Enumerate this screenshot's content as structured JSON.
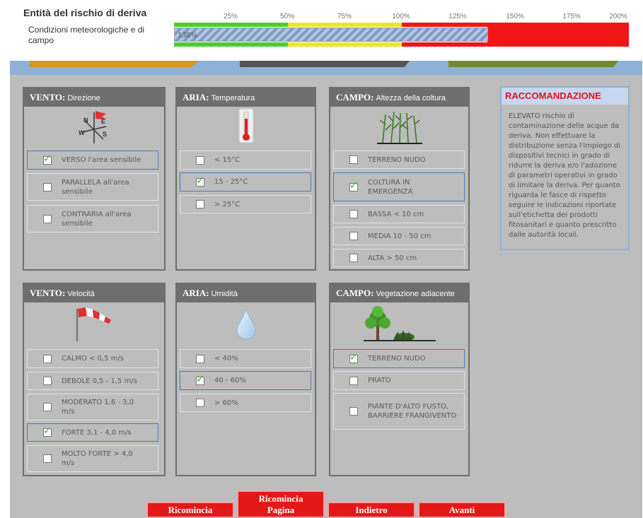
{
  "header": {
    "title": "Entità del rischio di deriva",
    "subtitle": "Condizioni meteorologiche e di campo",
    "scale_labels": [
      "25%",
      "50%",
      "75%",
      "100%",
      "125%",
      "150%",
      "175%",
      "200%"
    ],
    "gauge_value_text": "138%",
    "gauge_value_fraction": 0.69,
    "zone_colors": {
      "green": "#4ccf2e",
      "yellow": "#ece62a",
      "red": "#f01616"
    }
  },
  "panels": {
    "vento_dir": {
      "title_bold": "VENTO:",
      "title_rest": "Direzione",
      "icon": "weathervane-icon",
      "options": [
        {
          "label": "VERSO l'area sensibile",
          "checked": true
        },
        {
          "label": "PARALLELA all'area sensibile",
          "checked": false
        },
        {
          "label": "CONTRARIA all'area sensibile",
          "checked": false
        }
      ]
    },
    "aria_temp": {
      "title_bold": "ARIA:",
      "title_rest": "Temperatura",
      "icon": "thermometer-icon",
      "options": [
        {
          "label": "< 15°C",
          "checked": false
        },
        {
          "label": "15 - 25°C",
          "checked": true
        },
        {
          "label": "> 25°C",
          "checked": false
        }
      ]
    },
    "campo_alt": {
      "title_bold": "CAMPO:",
      "title_rest": "Altezza della coltura",
      "icon": "crop-icon",
      "options": [
        {
          "label": "TERRENO NUDO",
          "checked": false
        },
        {
          "label": "COLTURA IN EMERGENZA",
          "checked": true
        },
        {
          "label": "BASSA < 10 cm",
          "checked": false
        },
        {
          "label": "MEDIA 10 - 50 cm",
          "checked": false
        },
        {
          "label": "ALTA > 50 cm",
          "checked": false
        }
      ]
    },
    "vento_vel": {
      "title_bold": "VENTO:",
      "title_rest": "Velocità",
      "icon": "windsock-icon",
      "options": [
        {
          "label": "CALMO < 0,5 m/s",
          "checked": false
        },
        {
          "label": "DEBOLE 0,5 - 1,5 m/s",
          "checked": false
        },
        {
          "label": "MODERATO 1,6 - 3,0 m/s",
          "checked": false
        },
        {
          "label": "FORTE 3,1 - 4,0 m/s",
          "checked": true
        },
        {
          "label": "MOLTO FORTE > 4,0 m/s",
          "checked": false
        }
      ]
    },
    "aria_umid": {
      "title_bold": "ARIA:",
      "title_rest": "Umidità",
      "icon": "water-drop-icon",
      "options": [
        {
          "label": "< 40%",
          "checked": false
        },
        {
          "label": "40 - 60%",
          "checked": true
        },
        {
          "label": "> 60%",
          "checked": false
        }
      ]
    },
    "campo_veg": {
      "title_bold": "CAMPO:",
      "title_rest": "Vegetazione adiacente",
      "icon": "tree-icon",
      "options": [
        {
          "label": "TERRENO NUDO",
          "checked": true
        },
        {
          "label": "PRATO",
          "checked": false
        },
        {
          "label": "PIANTE D'ALTO FUSTO, BARRIERE FRANGIVENTO",
          "checked": false
        }
      ]
    }
  },
  "recommendation": {
    "title": "RACCOMANDAZIONE",
    "text": "ELEVATO rischio di contaminazione delle acque da deriva. Non effettuare la distribuzione senza l'impiego di dispositivi tecnici in grado di ridurre la deriva e/o l'adozione di parametri operativi in grado di limitare la deriva. Per quanto riguarda le fasce di rispetto seguire le indicazioni riportate sull'etichetta dei prodotti fitosanitari e quanto prescritto dalle autorità locali."
  },
  "buttons": {
    "restart": "Ricomincia",
    "restart_page_line1": "Ricomincia",
    "restart_page_line2": "Pagina",
    "back": "Indietro",
    "next": "Avanti"
  },
  "check_glyph": "✓"
}
